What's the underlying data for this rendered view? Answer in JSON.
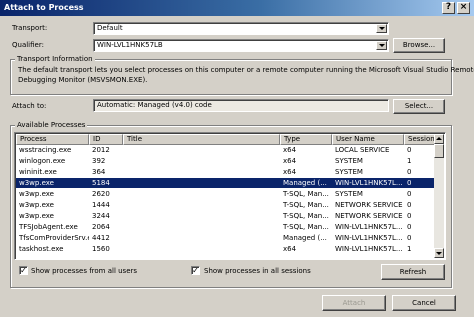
{
  "window": {
    "title": "Attach to Process",
    "help_label": "?",
    "close_label": "×"
  },
  "transport": {
    "label": "Transport:",
    "value": "Default"
  },
  "qualifier": {
    "label": "Qualifier:",
    "value": "WIN-LVL1HNK57LB",
    "browse_label": "Browse..."
  },
  "transport_info": {
    "group_title": "Transport Information",
    "line1": "The default transport lets you select processes on this computer or a remote computer running the Microsoft Visual Studio Remote",
    "line2": "Debugging Monitor (MSVSMON.EXE)."
  },
  "attach_to": {
    "label": "Attach to:",
    "value": "Automatic: Managed (v4.0) code",
    "select_label": "Select..."
  },
  "available": {
    "group_title": "Available Processes",
    "columns": [
      "Process",
      "ID",
      "Title",
      "Type",
      "User Name",
      "Session"
    ],
    "rows": [
      [
        "wsstracing.exe",
        "2012",
        "",
        "x64",
        "LOCAL SERVICE",
        "0"
      ],
      [
        "winlogon.exe",
        "392",
        "",
        "x64",
        "SYSTEM",
        "1"
      ],
      [
        "wininit.exe",
        "364",
        "",
        "x64",
        "SYSTEM",
        "0"
      ],
      [
        "w3wp.exe",
        "5184",
        "",
        "Managed (...",
        "WIN-LVL1HNK57L...",
        "0"
      ],
      [
        "w3wp.exe",
        "2620",
        "",
        "T-SQL, Man...",
        "SYSTEM",
        "0"
      ],
      [
        "w3wp.exe",
        "1444",
        "",
        "T-SQL, Man...",
        "NETWORK SERVICE",
        "0"
      ],
      [
        "w3wp.exe",
        "3244",
        "",
        "T-SQL, Man...",
        "NETWORK SERVICE",
        "0"
      ],
      [
        "TFSJobAgent.exe",
        "2064",
        "",
        "T-SQL, Man...",
        "WIN-LVL1HNK57L...",
        "0"
      ],
      [
        "TfsComProviderSrv.exe",
        "4412",
        "",
        "Managed (...",
        "WIN-LVL1HNK57L...",
        "0"
      ],
      [
        "taskhost.exe",
        "1560",
        "",
        "x64",
        "WIN-LVL1HNK57L...",
        "1"
      ]
    ],
    "selected_index": 3,
    "show_all_users_label": "Show processes from all users",
    "show_all_sessions_label": "Show processes in all sessions",
    "refresh_label": "Refresh",
    "check_mark": "✓"
  },
  "footer": {
    "attach_label": "Attach",
    "cancel_label": "Cancel"
  }
}
